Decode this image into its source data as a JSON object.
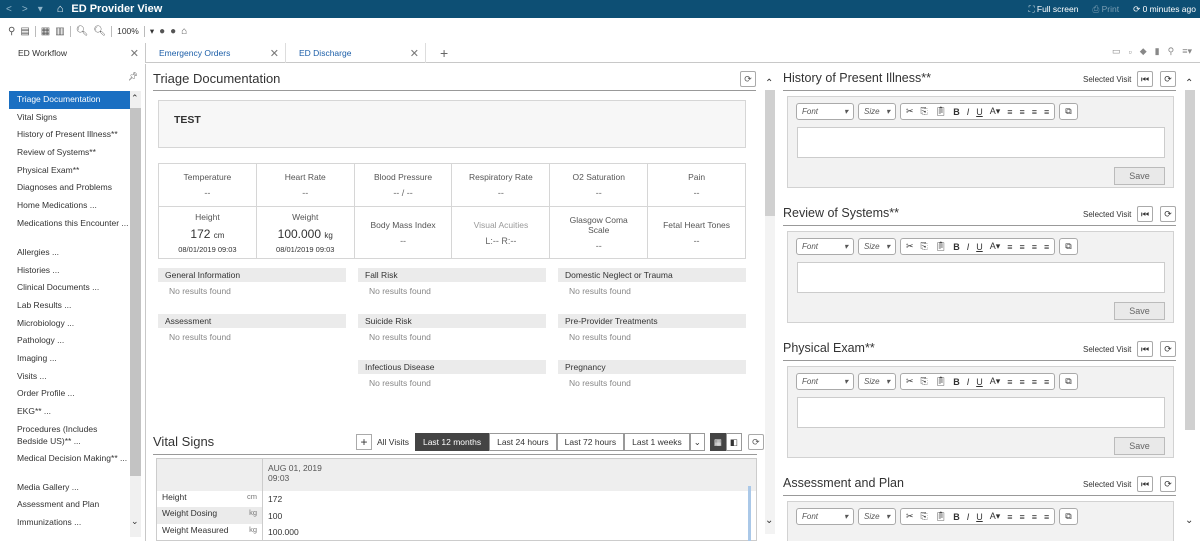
{
  "titlebar": {
    "title": "ED Provider View",
    "full_screen": "Full screen",
    "print": "Print",
    "updated": "0 minutes ago"
  },
  "toolbar": {
    "zoom": "100%"
  },
  "tabs": {
    "workflow": "ED Workflow",
    "emergency_orders": "Emergency Orders",
    "ed_discharge": "ED Discharge",
    "add": "+"
  },
  "sidebar": {
    "items": [
      "Triage Documentation",
      "Vital Signs",
      "History of Present Illness**",
      "Review of Systems**",
      "Physical Exam**",
      "Diagnoses and Problems",
      "Home Medications ...",
      "Medications this Encounter ...",
      "Allergies ...",
      "Histories ...",
      "Clinical Documents ...",
      "Lab Results ...",
      "Microbiology ...",
      "Pathology ...",
      "Imaging ...",
      "Visits ...",
      "Order Profile ...",
      "EKG** ...",
      "Procedures (Includes Bedside US)** ...",
      "Medical Decision Making** ...",
      "Media Gallery ...",
      "Assessment and Plan",
      "Immunizations ..."
    ]
  },
  "triage": {
    "title": "Triage Documentation",
    "note": "TEST",
    "vitals_row1": [
      {
        "label": "Temperature",
        "value": "--"
      },
      {
        "label": "Heart Rate",
        "value": "--"
      },
      {
        "label": "Blood Pressure",
        "value": "-- / --"
      },
      {
        "label": "Respiratory Rate",
        "value": "--"
      },
      {
        "label": "O2 Saturation",
        "value": "--"
      },
      {
        "label": "Pain",
        "value": "--"
      }
    ],
    "vitals_row2": {
      "height_label": "Height",
      "height_value": "172",
      "height_unit": "cm",
      "height_date": "08/01/2019 09:03",
      "weight_label": "Weight",
      "weight_value": "100.000",
      "weight_unit": "kg",
      "weight_date": "08/01/2019 09:03",
      "bmi_label": "Body Mass Index",
      "bmi_value": "--",
      "visual_label": "Visual Acuities",
      "visual_value": "L:--    R:--",
      "gcs_label": "Glasgow Coma Scale",
      "gcs_value": "--",
      "fetal_label": "Fetal Heart Tones",
      "fetal_value": "--"
    },
    "sections": [
      {
        "title": "General Information",
        "text": "No results found"
      },
      {
        "title": "Fall Risk",
        "text": "No results found"
      },
      {
        "title": "Domestic Neglect or Trauma",
        "text": "No results found"
      },
      {
        "title": "Assessment",
        "text": "No results found"
      },
      {
        "title": "Suicide Risk",
        "text": "No results found"
      },
      {
        "title": "Pre-Provider Treatments",
        "text": "No results found"
      },
      {
        "title": "Infectious Disease",
        "text": "No results found"
      },
      {
        "title": "Pregnancy",
        "text": "No results found"
      }
    ]
  },
  "vital_signs": {
    "title": "Vital Signs",
    "all_visits": "All Visits",
    "ranges": [
      "Last 12 months",
      "Last 24 hours",
      "Last 72 hours",
      "Last 1 weeks"
    ],
    "selected_range": "Last 12 months",
    "column_date": "AUG 01, 2019",
    "column_time": "09:03",
    "rows": [
      {
        "name": "Height",
        "unit": "cm",
        "value": "172"
      },
      {
        "name": "Weight Dosing",
        "unit": "kg",
        "value": "100"
      },
      {
        "name": "Weight Measured",
        "unit": "kg",
        "value": "100.000"
      }
    ]
  },
  "editors": {
    "selected_visit": "Selected Visit",
    "font": "Font",
    "size": "Size",
    "save": "Save",
    "sections": [
      "History of Present Illness**",
      "Review of Systems**",
      "Physical Exam**",
      "Assessment and Plan"
    ]
  },
  "colors": {
    "titlebar": "#0d4f74",
    "active_nav": "#1a6fc2",
    "link": "#1b5ea8"
  }
}
